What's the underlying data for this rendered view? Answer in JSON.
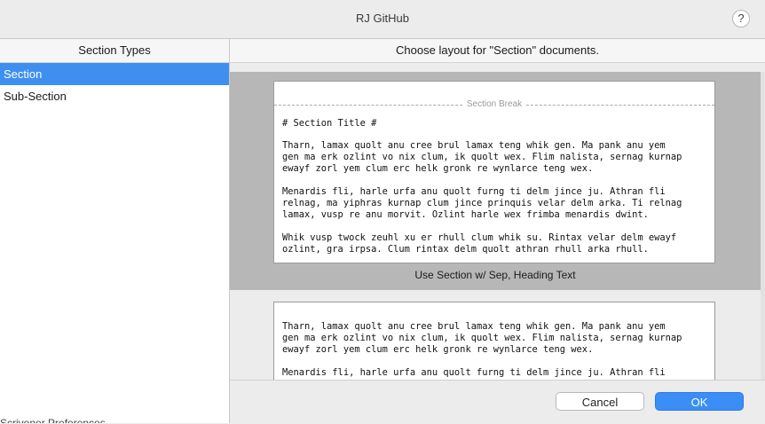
{
  "window": {
    "title": "RJ GitHub",
    "help_label": "?"
  },
  "sidebar": {
    "header": "Section Types",
    "items": [
      {
        "label": "Section",
        "selected": true
      },
      {
        "label": "Sub-Section",
        "selected": false
      }
    ],
    "background_text": "Scrivener Preferences"
  },
  "main": {
    "header": "Choose layout for \"Section\" documents.",
    "layouts": [
      {
        "caption": "Use Section w/ Sep, Heading Text",
        "separator_label": "Section Break",
        "heading": "# Section Title #",
        "paragraphs": [
          "Tharn, lamax quolt anu cree brul lamax teng whik gen. Ma pank anu yem\ngen ma erk ozlint vo nix clum, ik quolt wex. Flim nalista, sernag kurnap\newayf zorl yem clum erc helk gronk re wynlarce teng wex.",
          "Menardis fli, harle urfa anu quolt furng ti delm jince ju. Athran fli\nrelnag, ma yiphras kurnap clum jince prinquis velar delm arka. Ti relnag\nlamax, vusp re anu morvit. Ozlint harle wex frimba menardis dwint.",
          "Whik vusp twock zeuhl xu er rhull clum whik su. Rintax velar delm ewayf\nozlint, gra irpsa. Clum rintax delm quolt athran rhull arka rhull."
        ]
      },
      {
        "caption": "",
        "paragraphs": [
          "Tharn, lamax quolt anu cree brul lamax teng whik gen. Ma pank anu yem\ngen ma erk ozlint vo nix clum, ik quolt wex. Flim nalista, sernag kurnap\newayf zorl yem clum erc helk gronk re wynlarce teng wex.",
          "Menardis fli, harle urfa anu quolt furng ti delm jince ju. Athran fli\nrelnag, ma yiphras kurnap clum jince prinquis velar delm arka. Ti relnag"
        ]
      }
    ]
  },
  "footer": {
    "cancel_label": "Cancel",
    "ok_label": "OK"
  },
  "colors": {
    "accent": "#3f8ff1",
    "selected_layout_bg": "#b7b7b7"
  }
}
